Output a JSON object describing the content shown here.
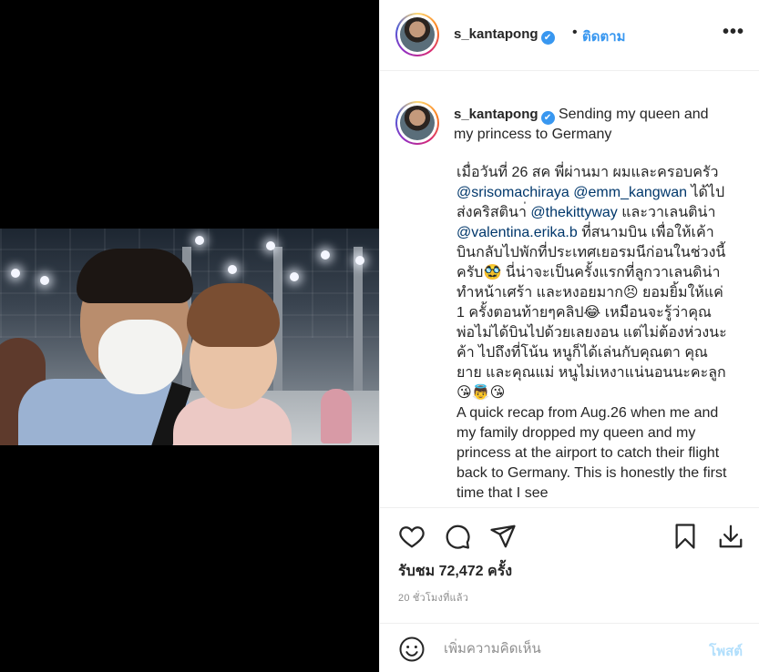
{
  "post": {
    "username": "s_kantapong",
    "verified_icon": "✔",
    "follow_dot": "•",
    "follow_label": "ติดตาม",
    "more_label": "•••"
  },
  "caption": {
    "title": "Sending my queen and my princess to Germany",
    "body": [
      {
        "t": "เมื่อวันที่ 26 สค พี่ผ่านมา ผมและครอบครัว "
      },
      {
        "t": "@srisomachiraya",
        "m": true
      },
      {
        "t": " "
      },
      {
        "t": "@emm_kangwan",
        "m": true
      },
      {
        "t": " ได้ไปส่งคริสตินา่ "
      },
      {
        "t": "@thekittyway",
        "m": true
      },
      {
        "t": " และวาเลนติน่า "
      },
      {
        "t": "@valentina.erika.b",
        "m": true
      },
      {
        "t": " ที่สนามบิน เพื่อให้เค้าบินกลับไปพักที่ประเทศเยอรมนีก่อนในช่วงนี้ครับ🥸 นี่น่าจะเป็นครั้งแรกที่ลูกวาเลนดิน่า ทำหน้าเศร้า และหงอยมาก😣 ยอมยิ้มให้แค่ 1 ครั้งตอนท้ายๆคลิป😂 เหมือนจะรู้ว่าคุณพ่อไม่ได้บินไปด้วยเลยงอน แต่ไม่ต้องห่วงนะค้า ไปถึงที่โน้น หนูก็ได้เล่นกับคุณตา คุณยาย และคุณแม่ หนูไม่เหงาแน่นอนนะคะลูก😘👼😘\nA quick recap from Aug.26 when me and my family dropped my queen and my princess at the airport to catch their flight back to Germany. This is honestly the first time that I see"
      }
    ]
  },
  "stats": {
    "likes": "รับชม 72,472 ครั้ง",
    "time": "20 ชั่วโมงที่แล้ว"
  },
  "comment": {
    "placeholder": "เพิ่มความคิดเห็น",
    "post_label": "โพสต์"
  },
  "icons": [
    "heart-icon",
    "comment-icon",
    "share-icon",
    "bookmark-icon",
    "download-icon",
    "smiley-icon"
  ],
  "colors": {
    "link": "#3897f0",
    "mention": "#00376b",
    "muted": "#8e8e8e",
    "post_disabled": "#b2dffc"
  }
}
